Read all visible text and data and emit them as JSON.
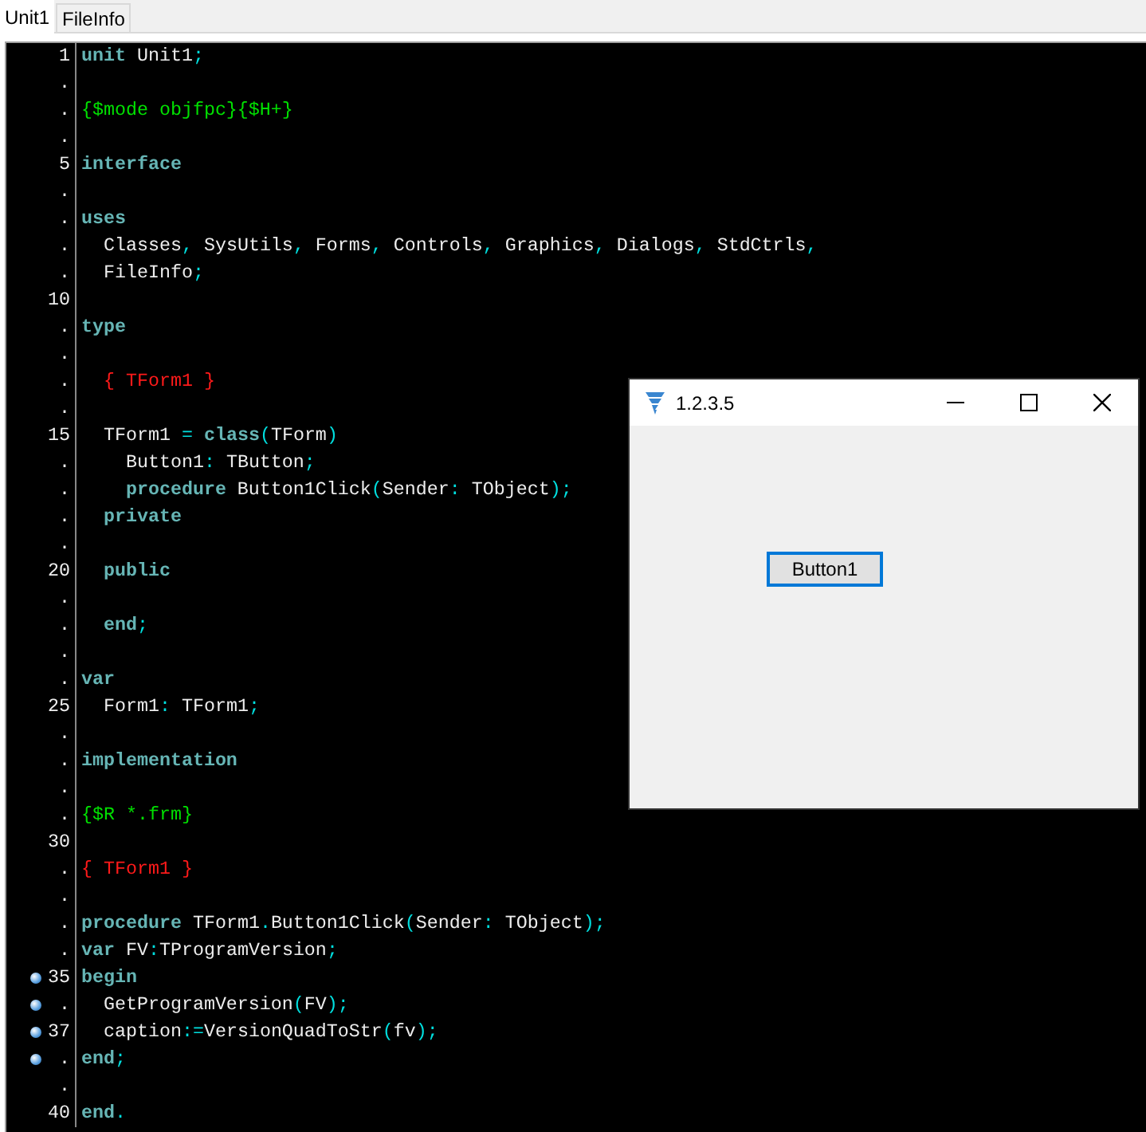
{
  "tabs": [
    {
      "label": "Unit1",
      "selected": true
    },
    {
      "label": "FileInfo",
      "selected": false
    }
  ],
  "editor": {
    "lines": [
      {
        "gutter": "1",
        "breakpoint": false,
        "tokens": [
          {
            "kind": "keyword",
            "text": "unit"
          },
          {
            "kind": "name",
            "text": " Unit1"
          },
          {
            "kind": "symbol",
            "text": ";"
          }
        ]
      },
      {
        "gutter": ".",
        "breakpoint": false
      },
      {
        "gutter": ".",
        "breakpoint": false,
        "tokens": [
          {
            "kind": "directive",
            "text": "{$mode objfpc}{$H+}"
          }
        ]
      },
      {
        "gutter": ".",
        "breakpoint": false
      },
      {
        "gutter": "5",
        "breakpoint": false,
        "tokens": [
          {
            "kind": "keyword",
            "text": "interface"
          }
        ]
      },
      {
        "gutter": ".",
        "breakpoint": false
      },
      {
        "gutter": ".",
        "breakpoint": false,
        "tokens": [
          {
            "kind": "keyword",
            "text": "uses"
          }
        ]
      },
      {
        "gutter": ".",
        "breakpoint": false,
        "tokens": [
          {
            "kind": "name",
            "text": "  Classes"
          },
          {
            "kind": "symbol",
            "text": ","
          },
          {
            "kind": "name",
            "text": " SysUtils"
          },
          {
            "kind": "symbol",
            "text": ","
          },
          {
            "kind": "name",
            "text": " Forms"
          },
          {
            "kind": "symbol",
            "text": ","
          },
          {
            "kind": "name",
            "text": " Controls"
          },
          {
            "kind": "symbol",
            "text": ","
          },
          {
            "kind": "name",
            "text": " Graphics"
          },
          {
            "kind": "symbol",
            "text": ","
          },
          {
            "kind": "name",
            "text": " Dialogs"
          },
          {
            "kind": "symbol",
            "text": ","
          },
          {
            "kind": "name",
            "text": " StdCtrls"
          },
          {
            "kind": "symbol",
            "text": ","
          }
        ]
      },
      {
        "gutter": ".",
        "breakpoint": false,
        "tokens": [
          {
            "kind": "name",
            "text": "  FileInfo"
          },
          {
            "kind": "symbol",
            "text": ";"
          }
        ]
      },
      {
        "gutter": "10",
        "breakpoint": false
      },
      {
        "gutter": ".",
        "breakpoint": false,
        "tokens": [
          {
            "kind": "keyword",
            "text": "type"
          }
        ]
      },
      {
        "gutter": ".",
        "breakpoint": false
      },
      {
        "gutter": ".",
        "breakpoint": false,
        "tokens": [
          {
            "kind": "comment",
            "text": "  { TForm1 }"
          }
        ]
      },
      {
        "gutter": ".",
        "breakpoint": false
      },
      {
        "gutter": "15",
        "breakpoint": false,
        "tokens": [
          {
            "kind": "name",
            "text": "  TForm1"
          },
          {
            "kind": "symbol",
            "text": " ="
          },
          {
            "kind": "keyword",
            "text": " class"
          },
          {
            "kind": "symbol",
            "text": "("
          },
          {
            "kind": "name",
            "text": "TForm"
          },
          {
            "kind": "symbol",
            "text": ")"
          }
        ]
      },
      {
        "gutter": ".",
        "breakpoint": false,
        "tokens": [
          {
            "kind": "name",
            "text": "    Button1"
          },
          {
            "kind": "symbol",
            "text": ":"
          },
          {
            "kind": "name",
            "text": " TButton"
          },
          {
            "kind": "symbol",
            "text": ";"
          }
        ]
      },
      {
        "gutter": ".",
        "breakpoint": false,
        "tokens": [
          {
            "kind": "keyword",
            "text": "    procedure"
          },
          {
            "kind": "name",
            "text": " Button1Click"
          },
          {
            "kind": "symbol",
            "text": "("
          },
          {
            "kind": "name",
            "text": "Sender"
          },
          {
            "kind": "symbol",
            "text": ":"
          },
          {
            "kind": "name",
            "text": " TObject"
          },
          {
            "kind": "symbol",
            "text": ");"
          }
        ]
      },
      {
        "gutter": ".",
        "breakpoint": false,
        "tokens": [
          {
            "kind": "keyword",
            "text": "  private"
          }
        ]
      },
      {
        "gutter": ".",
        "breakpoint": false
      },
      {
        "gutter": "20",
        "breakpoint": false,
        "tokens": [
          {
            "kind": "keyword",
            "text": "  public"
          }
        ]
      },
      {
        "gutter": ".",
        "breakpoint": false
      },
      {
        "gutter": ".",
        "breakpoint": false,
        "tokens": [
          {
            "kind": "keyword",
            "text": "  end"
          },
          {
            "kind": "symbol",
            "text": ";"
          }
        ]
      },
      {
        "gutter": ".",
        "breakpoint": false
      },
      {
        "gutter": ".",
        "breakpoint": false,
        "tokens": [
          {
            "kind": "keyword",
            "text": "var"
          }
        ]
      },
      {
        "gutter": "25",
        "breakpoint": false,
        "tokens": [
          {
            "kind": "name",
            "text": "  Form1"
          },
          {
            "kind": "symbol",
            "text": ":"
          },
          {
            "kind": "name",
            "text": " TForm1"
          },
          {
            "kind": "symbol",
            "text": ";"
          }
        ]
      },
      {
        "gutter": ".",
        "breakpoint": false
      },
      {
        "gutter": ".",
        "breakpoint": false,
        "tokens": [
          {
            "kind": "keyword",
            "text": "implementation"
          }
        ]
      },
      {
        "gutter": ".",
        "breakpoint": false
      },
      {
        "gutter": ".",
        "breakpoint": false,
        "tokens": [
          {
            "kind": "directive",
            "text": "{$R *.frm}"
          }
        ]
      },
      {
        "gutter": "30",
        "breakpoint": false
      },
      {
        "gutter": ".",
        "breakpoint": false,
        "tokens": [
          {
            "kind": "comment",
            "text": "{ TForm1 }"
          }
        ]
      },
      {
        "gutter": ".",
        "breakpoint": false
      },
      {
        "gutter": ".",
        "breakpoint": false,
        "tokens": [
          {
            "kind": "keyword",
            "text": "procedure"
          },
          {
            "kind": "name",
            "text": " TForm1"
          },
          {
            "kind": "symbol",
            "text": "."
          },
          {
            "kind": "name",
            "text": "Button1Click"
          },
          {
            "kind": "symbol",
            "text": "("
          },
          {
            "kind": "name",
            "text": "Sender"
          },
          {
            "kind": "symbol",
            "text": ":"
          },
          {
            "kind": "name",
            "text": " TObject"
          },
          {
            "kind": "symbol",
            "text": ");"
          }
        ]
      },
      {
        "gutter": ".",
        "breakpoint": false,
        "tokens": [
          {
            "kind": "keyword",
            "text": "var"
          },
          {
            "kind": "name",
            "text": " FV"
          },
          {
            "kind": "symbol",
            "text": ":"
          },
          {
            "kind": "name",
            "text": "TProgramVersion"
          },
          {
            "kind": "symbol",
            "text": ";"
          }
        ]
      },
      {
        "gutter": "35",
        "breakpoint": true,
        "tokens": [
          {
            "kind": "keyword",
            "text": "begin"
          }
        ]
      },
      {
        "gutter": ".",
        "breakpoint": true,
        "tokens": [
          {
            "kind": "name",
            "text": "  GetProgramVersion"
          },
          {
            "kind": "symbol",
            "text": "("
          },
          {
            "kind": "name",
            "text": "FV"
          },
          {
            "kind": "symbol",
            "text": ");"
          }
        ]
      },
      {
        "gutter": "37",
        "breakpoint": true,
        "tokens": [
          {
            "kind": "name",
            "text": "  caption"
          },
          {
            "kind": "symbol",
            "text": ":="
          },
          {
            "kind": "name",
            "text": "VersionQuadToStr"
          },
          {
            "kind": "symbol",
            "text": "("
          },
          {
            "kind": "name",
            "text": "fv"
          },
          {
            "kind": "symbol",
            "text": ");"
          }
        ]
      },
      {
        "gutter": ".",
        "breakpoint": true,
        "tokens": [
          {
            "kind": "keyword",
            "text": "end"
          },
          {
            "kind": "symbol",
            "text": ";"
          }
        ]
      },
      {
        "gutter": ".",
        "breakpoint": false
      },
      {
        "gutter": "40",
        "breakpoint": false,
        "tokens": [
          {
            "kind": "keyword",
            "text": "end"
          },
          {
            "kind": "symbol",
            "text": "."
          }
        ]
      }
    ]
  },
  "form_window": {
    "title": "1.2.3.5",
    "button": "Button1"
  }
}
